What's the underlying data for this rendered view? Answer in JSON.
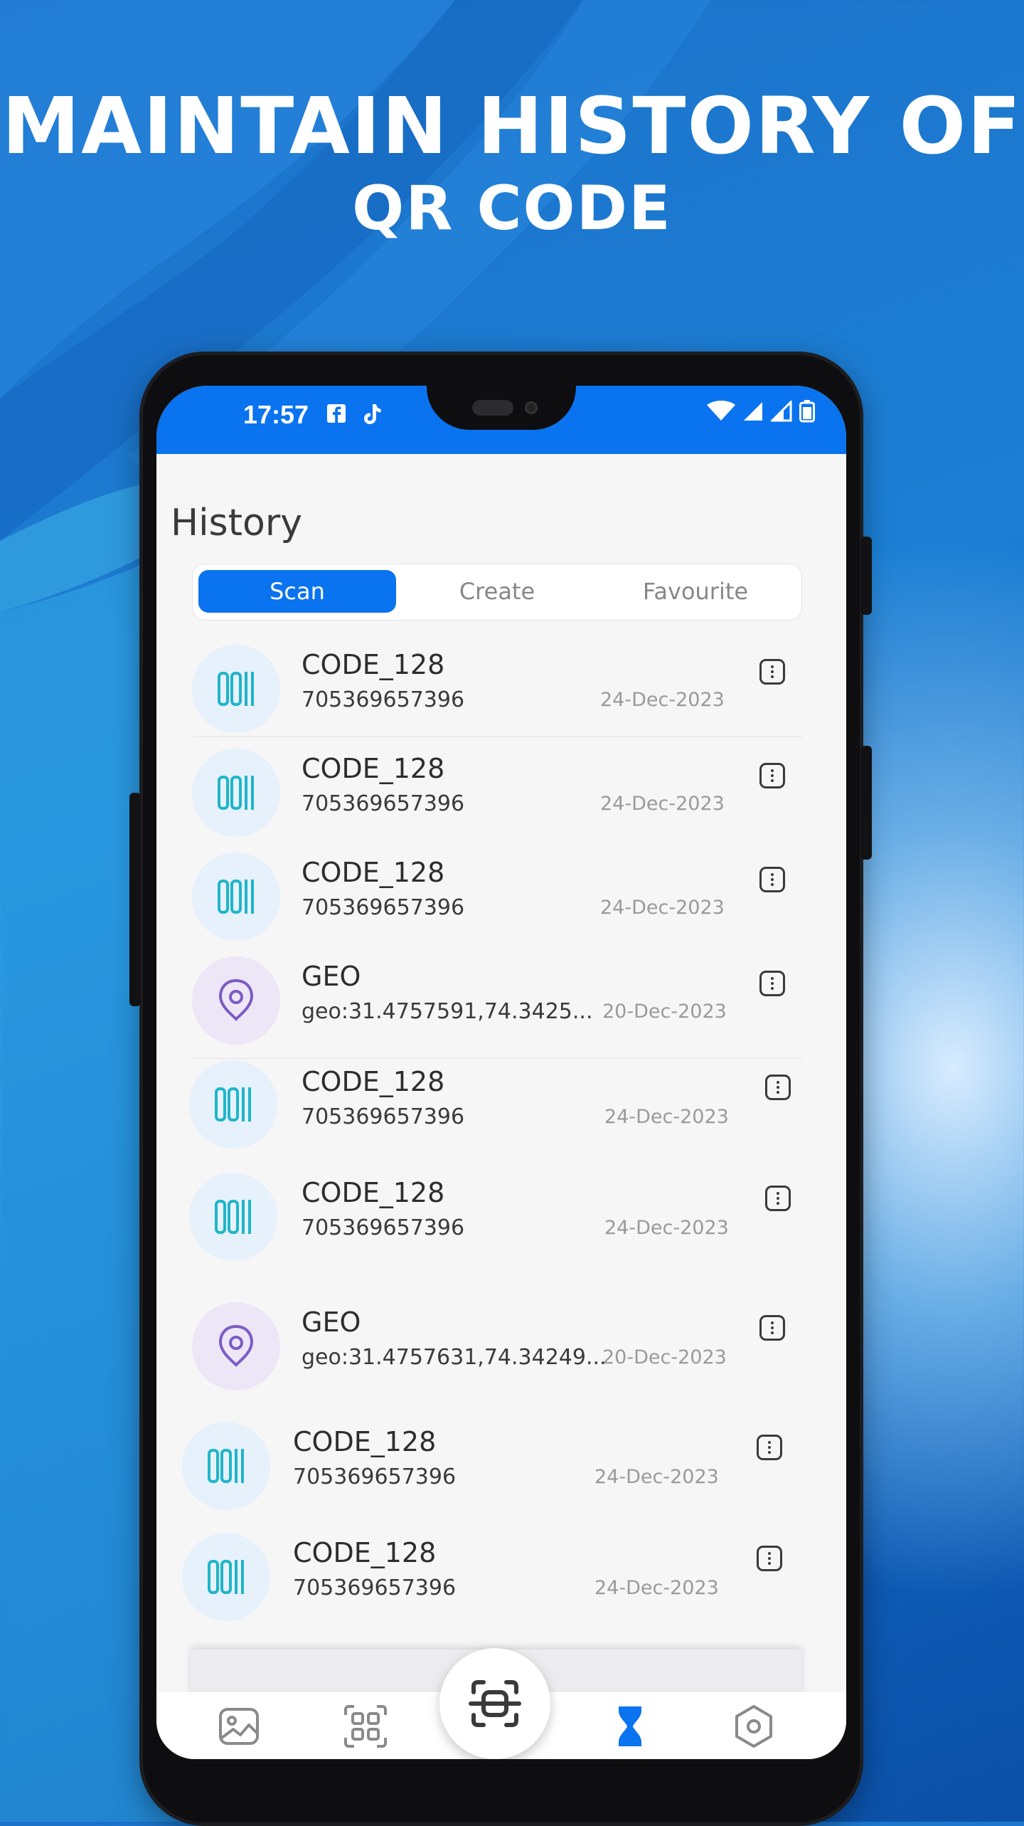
{
  "headline": {
    "line1": "MAINTAIN HISTORY OF",
    "line2": "QR CODE"
  },
  "status_bar": {
    "time": "17:57",
    "icons_left": [
      "facebook-icon",
      "tiktok-icon"
    ],
    "icons_right": [
      "wifi-icon",
      "signal-icon",
      "signal-icon",
      "battery-icon"
    ]
  },
  "page": {
    "title": "History"
  },
  "tabs": [
    {
      "label": "Scan",
      "active": true
    },
    {
      "label": "Create",
      "active": false
    },
    {
      "label": "Favourite",
      "active": false
    }
  ],
  "history": [
    {
      "type": "CODE_128",
      "value": "705369657396",
      "date": "24-Dec-2023",
      "icon": "barcode-icon"
    },
    {
      "type": "CODE_128",
      "value": "705369657396",
      "date": "24-Dec-2023",
      "icon": "barcode-icon"
    },
    {
      "type": "CODE_128",
      "value": "705369657396",
      "date": "24-Dec-2023",
      "icon": "barcode-icon"
    },
    {
      "type": "GEO",
      "value": "geo:31.4757591,74.3425...",
      "date": "20-Dec-2023",
      "icon": "location-pin-icon"
    },
    {
      "type": "CODE_128",
      "value": "705369657396",
      "date": "24-Dec-2023",
      "icon": "barcode-icon"
    },
    {
      "type": "CODE_128",
      "value": "705369657396",
      "date": "24-Dec-2023",
      "icon": "barcode-icon"
    },
    {
      "type": "GEO",
      "value": "geo:31.4757631,74.34249...",
      "date": "20-Dec-2023",
      "icon": "location-pin-icon"
    },
    {
      "type": "CODE_128",
      "value": "705369657396",
      "date": "24-Dec-2023",
      "icon": "barcode-icon"
    },
    {
      "type": "CODE_128",
      "value": "705369657396",
      "date": "24-Dec-2023",
      "icon": "barcode-icon"
    }
  ],
  "bottom_nav": [
    {
      "icon": "gallery-icon",
      "active": false
    },
    {
      "icon": "qr-generate-icon",
      "active": false
    },
    {
      "icon": "scan-icon",
      "active": false
    },
    {
      "icon": "history-hourglass-icon",
      "active": true
    },
    {
      "icon": "settings-icon",
      "active": false
    }
  ],
  "colors": {
    "accent": "#0a73ef",
    "barcode": "#1fb5c9",
    "geo": "#7b5cc4",
    "barcode_bg": "#e6f1fb",
    "geo_bg": "#ede6f7"
  }
}
